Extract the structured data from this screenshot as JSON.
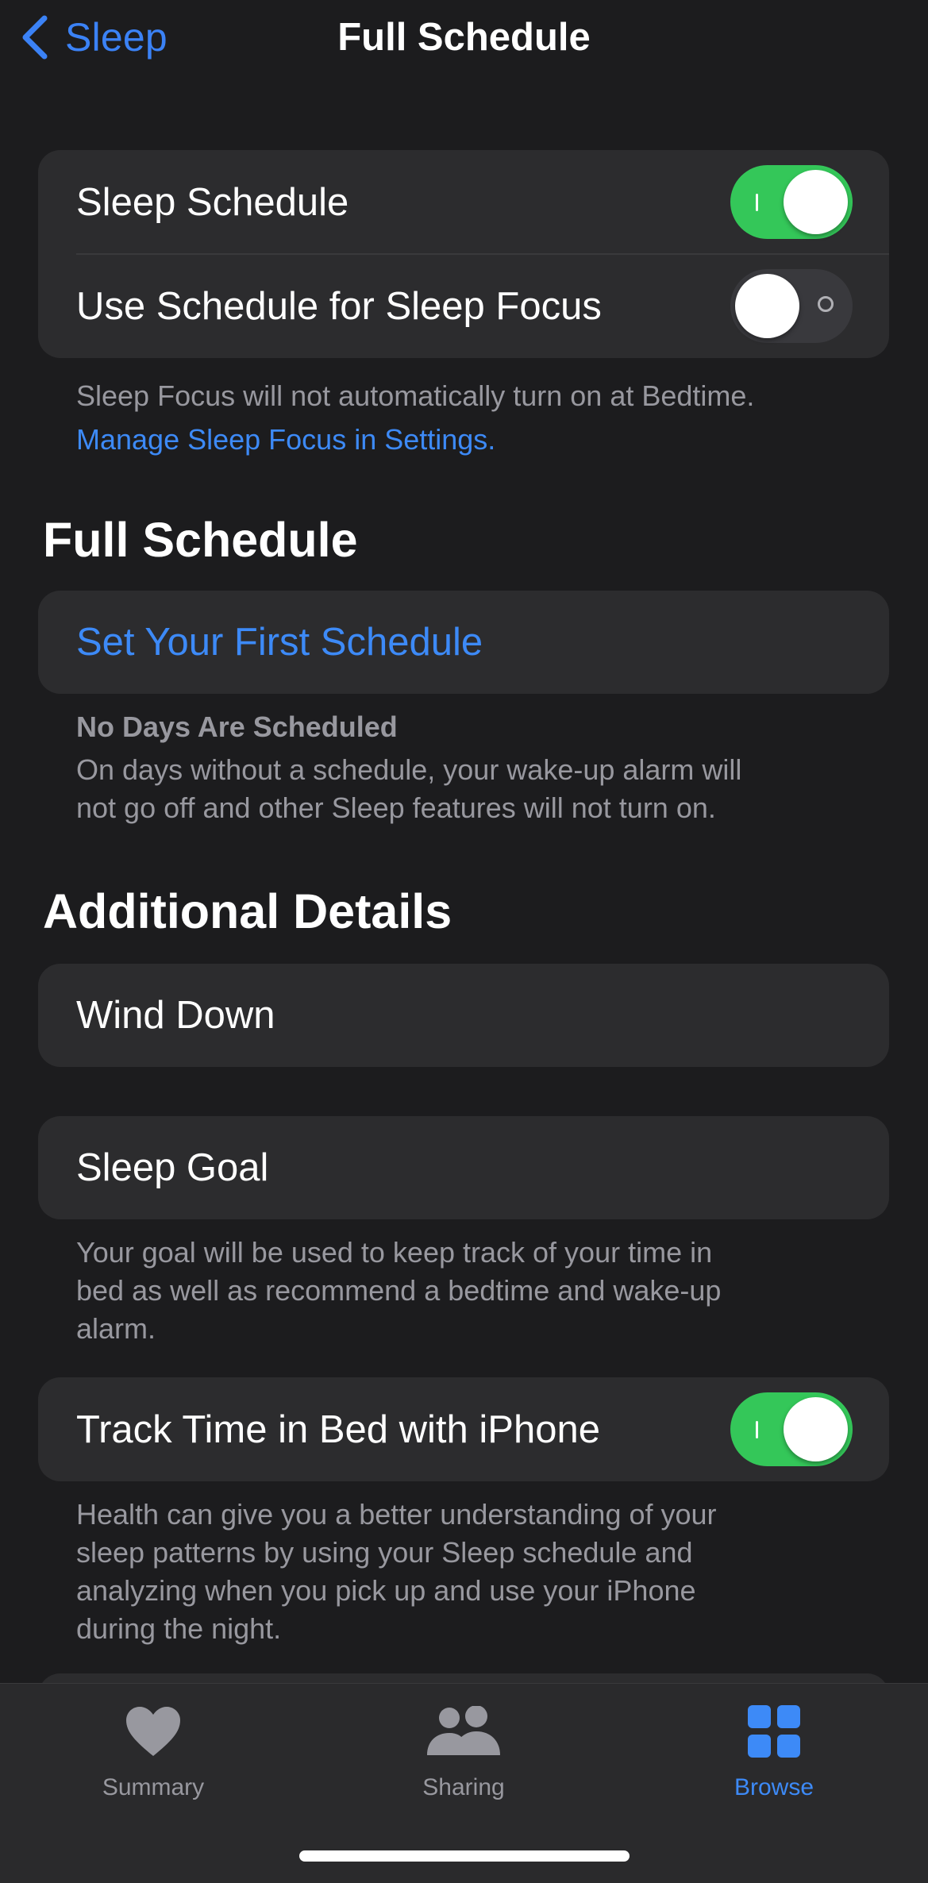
{
  "nav": {
    "back_label": "Sleep",
    "title": "Full Schedule"
  },
  "schedule_card": {
    "sleep_schedule_label": "Sleep Schedule",
    "sleep_schedule_on": true,
    "sleep_focus_label": "Use Schedule for Sleep Focus",
    "sleep_focus_on": false
  },
  "sleep_focus_note": {
    "text": "Sleep Focus will not automatically turn on at Bedtime.",
    "link": "Manage Sleep Focus in Settings."
  },
  "full_schedule": {
    "title": "Full Schedule",
    "set_first_label": "Set Your First Schedule",
    "note_title": "No Days Are Scheduled",
    "note_line1": "On days without a schedule, your wake-up alarm will",
    "note_line2": "not go off and other Sleep features will not turn on."
  },
  "additional": {
    "title": "Additional Details",
    "wind_down_label": "Wind Down",
    "sleep_goal_label": "Sleep Goal",
    "goal_note_line1": "Your goal will be used to keep track of your time in",
    "goal_note_line2": "bed as well as recommend a bedtime and wake-up",
    "goal_note_line3": "alarm.",
    "track_label": "Track Time in Bed with iPhone",
    "track_on": true,
    "track_note_line1": "Health can give you a better understanding of your",
    "track_note_line2": "sleep patterns by using your Sleep schedule and",
    "track_note_line3": "analyzing when you pick up and use your iPhone",
    "track_note_line4": "during the night."
  },
  "tabbar": {
    "tabs": [
      {
        "label": "Summary",
        "icon": "heart-icon",
        "active": false
      },
      {
        "label": "Sharing",
        "icon": "people-icon",
        "active": false
      },
      {
        "label": "Browse",
        "icon": "grid-icon",
        "active": true
      }
    ]
  },
  "colors": {
    "background": "#1c1c1e",
    "card": "#2c2c2e",
    "accent_blue": "#3d8af7",
    "toggle_green": "#34c759",
    "secondary_text": "#98989f"
  }
}
